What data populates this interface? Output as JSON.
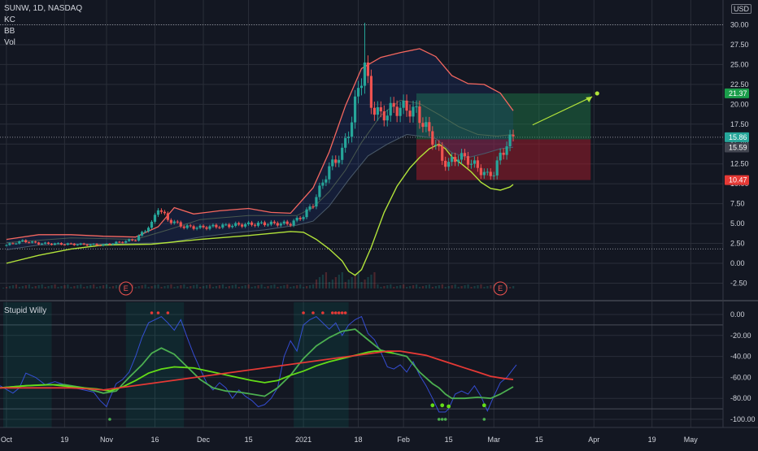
{
  "header": {
    "symbol_line": "SUNW, 1D, NASDAQ",
    "indicators": [
      "KC",
      "BB",
      "Vol"
    ],
    "currency": "USD",
    "oscillator_title": "Stupid Willy"
  },
  "colors": {
    "background": "#131722",
    "grid": "#2a2e39",
    "up": "#26a69a",
    "down": "#ef5350",
    "bb_line": "#f5675f",
    "kc_line": "#b2e33a",
    "target_zone": "#1e7e4a",
    "stop_zone": "#9b1c2a",
    "osc_fast": "#3d5afe",
    "osc_green": "#64dd17",
    "osc_red": "#e53935"
  },
  "chart_data": [
    {
      "type": "line",
      "name": "price-pane",
      "y_ticks": [
        "30.00",
        "27.50",
        "25.00",
        "22.50",
        "20.00",
        "17.50",
        "15.00",
        "12.50",
        "10.00",
        "7.50",
        "5.00",
        "2.50",
        "0.00",
        "-2.50"
      ],
      "ylim": [
        -3.6,
        32.5
      ],
      "x_ticks": [
        "Oct",
        "19",
        "Nov",
        "16",
        "Dec",
        "15",
        "2021",
        "18",
        "Feb",
        "15",
        "Mar",
        "15",
        "Apr",
        "19",
        "May"
      ],
      "x_tick_days": [
        0,
        18,
        31,
        46,
        61,
        75,
        92,
        109,
        123,
        137,
        151,
        165,
        182,
        200,
        212
      ],
      "x_range_days": [
        -2,
        222
      ],
      "earnings_markers": [
        {
          "day": 37,
          "label": "E"
        },
        {
          "day": 153,
          "label": "E"
        }
      ],
      "candles": [],
      "bb_upper": [
        [
          0,
          3.0
        ],
        [
          10,
          3.6
        ],
        [
          20,
          3.6
        ],
        [
          30,
          3.4
        ],
        [
          40,
          3.3
        ],
        [
          47,
          4.6
        ],
        [
          52,
          7.0
        ],
        [
          58,
          6.2
        ],
        [
          66,
          6.6
        ],
        [
          75,
          6.9
        ],
        [
          82,
          6.4
        ],
        [
          88,
          6.3
        ],
        [
          95,
          9.5
        ],
        [
          100,
          14
        ],
        [
          105,
          19.8
        ],
        [
          110,
          24.5
        ],
        [
          116,
          25.9
        ],
        [
          122,
          26.5
        ],
        [
          128,
          27.0
        ],
        [
          133,
          26.0
        ],
        [
          138,
          23.6
        ],
        [
          143,
          22.6
        ],
        [
          148,
          22.5
        ],
        [
          153,
          21.4
        ],
        [
          157,
          19.2
        ]
      ],
      "bb_lower": [
        [
          0,
          1.7
        ],
        [
          10,
          2.3
        ],
        [
          20,
          2.4
        ],
        [
          30,
          2.4
        ],
        [
          40,
          2.5
        ],
        [
          50,
          2.6
        ],
        [
          60,
          3.3
        ],
        [
          70,
          3.8
        ],
        [
          80,
          4.2
        ],
        [
          90,
          4.8
        ],
        [
          95,
          5.3
        ],
        [
          100,
          7.2
        ],
        [
          106,
          10.5
        ],
        [
          112,
          13.5
        ],
        [
          118,
          15.0
        ],
        [
          124,
          16.2
        ],
        [
          128,
          16.0
        ],
        [
          133,
          15.7
        ],
        [
          138,
          13.9
        ],
        [
          143,
          13.3
        ],
        [
          148,
          13.8
        ],
        [
          153,
          14.4
        ],
        [
          157,
          14.6
        ]
      ],
      "kc_upper": [
        [
          0,
          2.6
        ],
        [
          20,
          3.2
        ],
        [
          40,
          3.0
        ],
        [
          50,
          4.2
        ],
        [
          60,
          5.5
        ],
        [
          75,
          6.0
        ],
        [
          90,
          6.0
        ],
        [
          95,
          7.0
        ],
        [
          100,
          9.0
        ],
        [
          105,
          11.7
        ],
        [
          110,
          15.2
        ],
        [
          116,
          18.6
        ],
        [
          122,
          20.5
        ],
        [
          128,
          20.1
        ],
        [
          134,
          18.7
        ],
        [
          140,
          17.2
        ],
        [
          146,
          16.2
        ],
        [
          152,
          16.0
        ],
        [
          157,
          16.2
        ]
      ],
      "kc_lower": [
        [
          0,
          0.0
        ],
        [
          10,
          1.0
        ],
        [
          20,
          1.8
        ],
        [
          30,
          2.3
        ],
        [
          45,
          2.4
        ],
        [
          60,
          3.0
        ],
        [
          75,
          3.5
        ],
        [
          88,
          4.0
        ],
        [
          92,
          3.9
        ],
        [
          96,
          3.0
        ],
        [
          100,
          1.8
        ],
        [
          104,
          0.3
        ],
        [
          106,
          -1.0
        ],
        [
          108,
          -1.5
        ],
        [
          110,
          -0.8
        ],
        [
          113,
          2.0
        ],
        [
          117,
          6.4
        ],
        [
          121,
          9.7
        ],
        [
          125,
          12.0
        ],
        [
          128,
          13.3
        ],
        [
          131,
          14.4
        ],
        [
          134,
          15.0
        ],
        [
          136,
          14.4
        ],
        [
          138,
          13.4
        ],
        [
          141,
          12.5
        ],
        [
          144,
          11.5
        ],
        [
          147,
          10.2
        ],
        [
          150,
          9.4
        ],
        [
          153,
          9.2
        ],
        [
          156,
          9.6
        ],
        [
          157,
          9.9
        ]
      ],
      "position_tool": {
        "entry": 15.59,
        "target": 21.37,
        "stop": 10.47,
        "current": 15.86,
        "start_day": 127,
        "end_day": 181,
        "labels": {
          "target": "21.37",
          "current": "15.86",
          "entry": "15.59",
          "stop": "10.47"
        }
      },
      "projection_arrow": {
        "from": [
          163,
          17.4
        ],
        "to": [
          183,
          21.37
        ]
      }
    },
    {
      "type": "line",
      "name": "stupid-willy-oscillator",
      "y_ticks": [
        "0.00",
        "-20.00",
        "-40.00",
        "-60.00",
        "-80.00",
        "-100.00"
      ],
      "ylim": [
        -104,
        6
      ],
      "series": [
        {
          "key": "fast",
          "points": [
            [
              -2,
              -68
            ],
            [
              2,
              -75
            ],
            [
              4,
              -70
            ],
            [
              6,
              -56
            ],
            [
              9,
              -60
            ],
            [
              12,
              -67
            ],
            [
              15,
              -64
            ],
            [
              18,
              -67
            ],
            [
              21,
              -70
            ],
            [
              24,
              -72
            ],
            [
              27,
              -74
            ],
            [
              29,
              -82
            ],
            [
              31,
              -88
            ],
            [
              32,
              -80
            ],
            [
              34,
              -66
            ],
            [
              36,
              -62
            ],
            [
              38,
              -55
            ],
            [
              40,
              -40
            ],
            [
              42,
              -22
            ],
            [
              44,
              -8
            ],
            [
              46,
              -5
            ],
            [
              48,
              -2
            ],
            [
              50,
              -8
            ],
            [
              52,
              -15
            ],
            [
              54,
              -5
            ],
            [
              56,
              -22
            ],
            [
              58,
              -38
            ],
            [
              60,
              -52
            ],
            [
              62,
              -65
            ],
            [
              64,
              -72
            ],
            [
              66,
              -65
            ],
            [
              68,
              -70
            ],
            [
              70,
              -80
            ],
            [
              72,
              -72
            ],
            [
              74,
              -78
            ],
            [
              76,
              -82
            ],
            [
              78,
              -88
            ],
            [
              80,
              -86
            ],
            [
              82,
              -80
            ],
            [
              84,
              -70
            ],
            [
              86,
              -40
            ],
            [
              88,
              -25
            ],
            [
              90,
              -35
            ],
            [
              92,
              -10
            ],
            [
              94,
              -5
            ],
            [
              96,
              -2
            ],
            [
              98,
              -8
            ],
            [
              100,
              -14
            ],
            [
              102,
              -8
            ],
            [
              104,
              -20
            ],
            [
              106,
              -10
            ],
            [
              108,
              -5
            ],
            [
              110,
              -2
            ],
            [
              112,
              -18
            ],
            [
              114,
              -24
            ],
            [
              116,
              -36
            ],
            [
              118,
              -50
            ],
            [
              120,
              -52
            ],
            [
              122,
              -48
            ],
            [
              124,
              -55
            ],
            [
              126,
              -45
            ],
            [
              128,
              -58
            ],
            [
              130,
              -68
            ],
            [
              132,
              -80
            ],
            [
              134,
              -93
            ],
            [
              136,
              -93
            ],
            [
              137,
              -90
            ],
            [
              139,
              -76
            ],
            [
              141,
              -73
            ],
            [
              143,
              -76
            ],
            [
              145,
              -68
            ],
            [
              147,
              -78
            ],
            [
              149,
              -92
            ],
            [
              151,
              -78
            ],
            [
              153,
              -65
            ],
            [
              155,
              -60
            ],
            [
              157,
              -52
            ],
            [
              158,
              -48
            ]
          ]
        },
        {
          "key": "green",
          "points": [
            [
              -2,
              -70
            ],
            [
              6,
              -68
            ],
            [
              12,
              -67
            ],
            [
              18,
              -67
            ],
            [
              24,
              -70
            ],
            [
              30,
              -75
            ],
            [
              34,
              -73
            ],
            [
              38,
              -60
            ],
            [
              42,
              -48
            ],
            [
              45,
              -37
            ],
            [
              48,
              -32
            ],
            [
              52,
              -38
            ],
            [
              56,
              -50
            ],
            [
              60,
              -62
            ],
            [
              64,
              -70
            ],
            [
              68,
              -73
            ],
            [
              72,
              -74
            ],
            [
              76,
              -76
            ],
            [
              80,
              -78
            ],
            [
              84,
              -70
            ],
            [
              88,
              -58
            ],
            [
              92,
              -42
            ],
            [
              96,
              -30
            ],
            [
              100,
              -22
            ],
            [
              104,
              -16
            ],
            [
              108,
              -14
            ],
            [
              112,
              -24
            ],
            [
              116,
              -34
            ],
            [
              120,
              -37
            ],
            [
              124,
              -40
            ],
            [
              128,
              -55
            ],
            [
              132,
              -66
            ],
            [
              134,
              -70
            ],
            [
              136,
              -76
            ],
            [
              138,
              -80
            ],
            [
              142,
              -80
            ],
            [
              146,
              -79
            ],
            [
              150,
              -80
            ],
            [
              153,
              -76
            ],
            [
              157,
              -69
            ]
          ]
        },
        {
          "key": "lime",
          "points": [
            [
              -2,
              -70
            ],
            [
              6,
              -68
            ],
            [
              14,
              -67
            ],
            [
              20,
              -69
            ],
            [
              28,
              -71
            ],
            [
              32,
              -73
            ],
            [
              36,
              -69
            ],
            [
              40,
              -63
            ],
            [
              44,
              -56
            ],
            [
              48,
              -52
            ],
            [
              52,
              -50
            ],
            [
              58,
              -51
            ],
            [
              64,
              -55
            ],
            [
              70,
              -59
            ],
            [
              76,
              -63
            ],
            [
              80,
              -65
            ],
            [
              84,
              -63
            ],
            [
              88,
              -58
            ],
            [
              92,
              -54
            ],
            [
              96,
              -49
            ],
            [
              100,
              -45
            ],
            [
              104,
              -42
            ],
            [
              108,
              -39
            ],
            [
              112,
              -36
            ],
            [
              114,
              -35
            ],
            [
              116,
              -35
            ],
            [
              120,
              -37
            ]
          ]
        },
        {
          "key": "red",
          "points": [
            [
              -2,
              -70
            ],
            [
              10,
              -70
            ],
            [
              20,
              -70
            ],
            [
              26,
              -71
            ],
            [
              30,
              -72
            ],
            [
              118,
              -35
            ],
            [
              122,
              -35
            ],
            [
              126,
              -37
            ],
            [
              130,
              -39
            ],
            [
              134,
              -43
            ],
            [
              138,
              -47
            ],
            [
              142,
              -51
            ],
            [
              146,
              -55
            ],
            [
              150,
              -59
            ],
            [
              154,
              -61
            ],
            [
              157,
              -62
            ]
          ]
        }
      ],
      "highlight_ranges": [
        [
          -1,
          14
        ],
        [
          37,
          55
        ],
        [
          89,
          106
        ]
      ],
      "top_markers_days": [
        45,
        47,
        50,
        92,
        95,
        98,
        101,
        102,
        103,
        104,
        105
      ],
      "bottom_markers": [
        [
          132,
          -89
        ],
        [
          135,
          -89
        ],
        [
          137,
          -90
        ],
        [
          148,
          -89
        ]
      ],
      "bottom_green_dots_days": [
        32,
        148
      ],
      "bottom_triples_days": [
        134,
        135,
        136
      ]
    }
  ]
}
